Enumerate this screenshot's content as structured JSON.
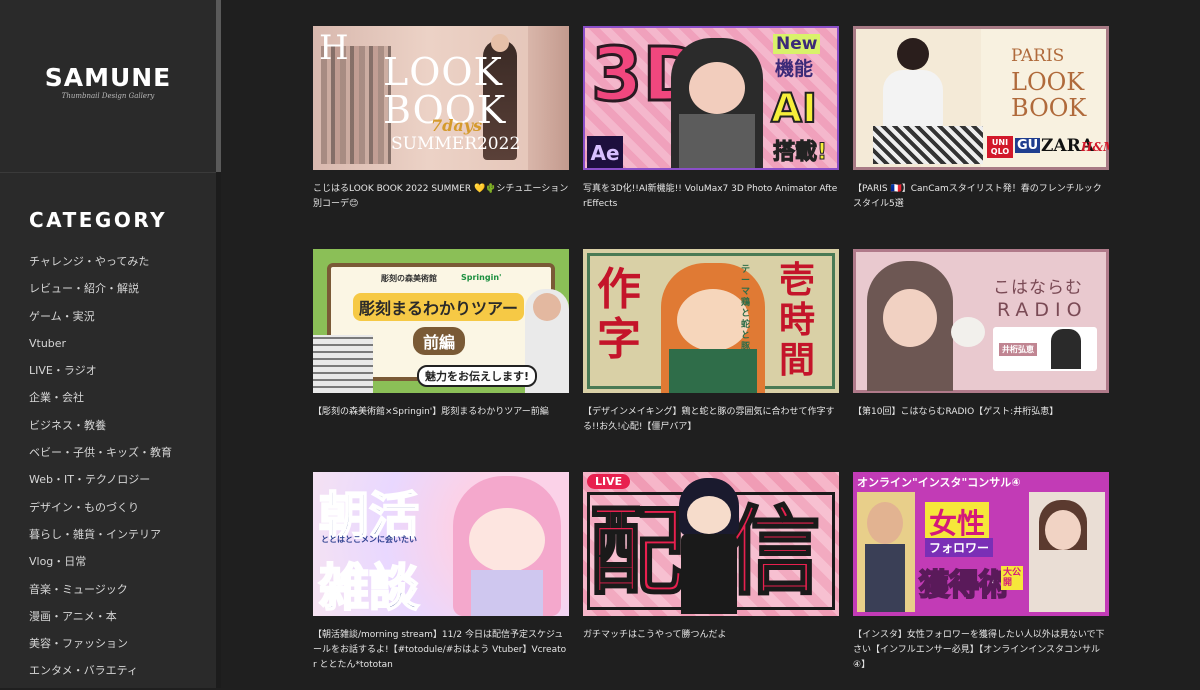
{
  "site": {
    "logo": "SAMUNE",
    "tagline": "Thumbnail Design Gallery"
  },
  "sidebar": {
    "heading": "CATEGORY",
    "items": [
      "チャレンジ・やってみた",
      "レビュー・紹介・解説",
      "ゲーム・実況",
      "Vtuber",
      "LIVE・ラジオ",
      "企業・会社",
      "ビジネス・教養",
      "ベビー・子供・キッズ・教育",
      "Web・IT・テクノロジー",
      "デザイン・ものづくり",
      "暮らし・雑貨・インテリア",
      "Vlog・日常",
      "音楽・ミュージック",
      "漫画・アニメ・本",
      "美容・ファッション",
      "エンタメ・バラエティ"
    ]
  },
  "cards": [
    {
      "caption": "こじはるLOOK BOOK 2022 SUMMER 💛🌵シチュエーション別コーデ😊",
      "thumb": {
        "a": "H",
        "b": "LOOK",
        "c": "BOOK",
        "d": "7days",
        "e": "SUMMER2022"
      }
    },
    {
      "caption": "写真を3D化!!AI新機能!! VoluMax7 3D Photo Animator AfterEffects",
      "thumb": {
        "a": "3D",
        "b": "New",
        "c": "機能",
        "d": "AI",
        "e": "搭載!",
        "f": "Ae"
      }
    },
    {
      "caption": "【PARIS 🇫🇷】CanCamスタイリスト発！春のフレンチルックスタイル5選",
      "thumb": {
        "a": "PARIS",
        "b": "LOOK",
        "c": "BOOK",
        "d": "UNI QLO",
        "e": "GU",
        "f": "ZARA",
        "g": "H&M"
      }
    },
    {
      "caption": "【彫刻の森美術館×Springin'】彫刻まるわかりツアー前編",
      "thumb": {
        "a": "彫刻の森美術館",
        "b": "Springin'",
        "c": "彫刻まるわかりツアー",
        "d": "前編",
        "e": "魅力をお伝えします!"
      }
    },
    {
      "caption": "【デザインメイキング】鶏と蛇と豚の雰囲気に合わせて作字する!!お久!心配!【僵尸バア】",
      "thumb": {
        "a": "作字",
        "b": "壱時間",
        "c": "テーマ 鶏と蛇と豚"
      }
    },
    {
      "caption": "【第10回】こはならむRADIO【ゲスト:井桁弘恵】",
      "thumb": {
        "a": "こはならむ",
        "b": "RADIO",
        "c": "井桁弘恵"
      }
    },
    {
      "caption": "【朝活雑談/morning stream】11/2 今日は配信予定スケジュールをお話するよ!【#totodule/#おはよう Vtuber】Vcreator ととたん*tototan",
      "thumb": {
        "a": "朝活",
        "b": "雑談",
        "c": "ととはとこメンに会いたい"
      }
    },
    {
      "caption": "ガチマッチはこうやって勝つんだよ",
      "thumb": {
        "a": "LIVE",
        "b": "配信"
      }
    },
    {
      "caption": "【インスタ】女性フォロワーを獲得したい人以外は見ないで下さい【インフルエンサー必見】【オンラインインスタコンサル④】",
      "thumb": {
        "a": "オンライン\"インスタ\"コンサル④",
        "b": "女性",
        "c": "フォロワー",
        "d": "獲得術",
        "e": "大公開"
      }
    }
  ],
  "colors": {
    "background": "#1f1f1f",
    "sidebar": "#2a2a2a",
    "text": "#e6e6e6"
  }
}
